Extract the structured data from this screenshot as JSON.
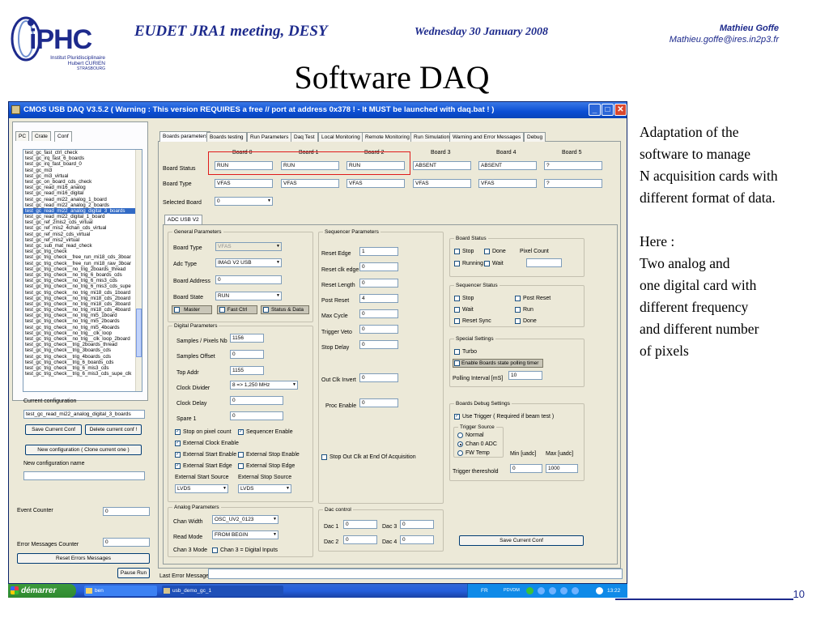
{
  "slide": {
    "meeting": "EUDET JRA1 meeting, DESY",
    "date": "Wednesday 30 January 2008",
    "author_name": "Mathieu Goffe",
    "author_email": "Mathieu.goffe@ires.in2p3.fr",
    "title": "Software DAQ",
    "page_number": "10",
    "logo": {
      "main": "iPHC",
      "line1": "Institut Pluridisciplinaire",
      "line2": "Hubert CURIEN",
      "line3": "STRASBOURG"
    },
    "side_text_1": "Adaptation of the\nsoftware to manage\nN acquisition cards with\ndifferent format of data.",
    "side_text_2": "Here :\nTwo analog and\none digital card with\ndifferent frequency\nand different number\nof pixels"
  },
  "window": {
    "title": "CMOS USB DAQ V3.5.2  ( Warning : This version REQUIRES a free // port at address 0x378 ! - It MUST be launched with daq.bat ! )",
    "btn_min": "_",
    "btn_max": "□",
    "btn_close": "✕"
  },
  "left": {
    "tabs": [
      "PC",
      "Crate",
      "Conf"
    ],
    "configs": [
      "test_gc_fast_ctrl_check",
      "test_gc_irq_fast_6_boards",
      "test_gc_irq_fast_board_0",
      "test_gc_mi3",
      "test_gc_mi3_virtual",
      "test_gc_on_board_cds_check",
      "test_gc_read_mi16_analog",
      "test_gc_read_mi16_digital",
      "test_gc_read_mi22_analog_1_board",
      "test_gc_read_mi22_analog_2_boards",
      "test_gc_read_mi22_analog_digital_3_boards",
      "test_gc_read_mi22_digital_1_board",
      "test_gc_ref_2mis2_cds_virtual",
      "test_gc_ref_mis2_4chan_cds_virtual",
      "test_gc_ref_mis2_cds_virtual",
      "test_gc_ref_mis2_virtual",
      "test_gc_sub_mat_read_check",
      "test_gc_trig_check",
      "test_gc_trig_check__free_run_mi18_cds_3boar",
      "test_gc_trig_check__free_run_mi18_raw_3boar",
      "test_gc_trig_check__no_trig_2boards_thread",
      "test_gc_trig_check__no_trig_6_boards_cds",
      "test_gc_trig_check__no_trig_6_mis3_cds",
      "test_gc_trig_check__no_trig_6_mis3_cds_supe",
      "test_gc_trig_check__no_trig_mi18_cds_1board",
      "test_gc_trig_check__no_trig_mi18_cds_2board",
      "test_gc_trig_check__no_trig_mi18_cds_3board",
      "test_gc_trig_check__no_trig_mi18_cds_4board",
      "test_gc_trig_check__no_trig_mi5_1board",
      "test_gc_trig_check__no_trig_mi5_2boards",
      "test_gc_trig_check__no_trig_mi5_4boards",
      "test_gc_trig_check__no_trig__clk_loop",
      "test_gc_trig_check__no_trig__clk_loop_2board",
      "test_gc_trig_check__trig_2boards_thread",
      "test_gc_trig_check__trig_3boards_cds",
      "test_gc_trig_check__trig_4boards_cds",
      "test_gc_trig_check__trig_6_boards_cds",
      "test_gc_trig_check__trig_6_mis3_cds",
      "test_gc_trig_check__trig_6_mis3_cds_supe_clk"
    ],
    "selected_index": 10,
    "current_config_label": "Current configuration",
    "current_config_value": "test_gc_read_mi22_analog_digital_3_boards",
    "save_current": "Save Current Conf",
    "delete_current": "Delete current conf !",
    "new_config_btn": "New configuration ( Clone current one )",
    "new_config_name_label": "New configuration name",
    "new_config_name_value": "",
    "event_counter_label": "Event Counter",
    "event_counter_value": "0",
    "error_counter_label": "Error Messages Counter",
    "error_counter_value": "0",
    "reset_errors": "Reset Errors Messages",
    "pause_run": "Pause Run"
  },
  "main": {
    "tabs": [
      "Boards parameters",
      "Boards testing",
      "Run Parameters",
      "Daq Test",
      "Local Monitoring",
      "Remote Monitoring",
      "Run Simulation",
      "Warning and Error Messages",
      "Debug"
    ],
    "boards": [
      "Board 0",
      "Board 1",
      "Board 2",
      "Board 3",
      "Board 4",
      "Board 5"
    ],
    "board_status_label": "Board Status",
    "board_status": [
      "RUN",
      "RUN",
      "RUN",
      "ABSENT",
      "ABSENT",
      "?"
    ],
    "board_type_label": "Board Type",
    "board_type": [
      "VFAS",
      "VFAS",
      "VFAS",
      "VFAS",
      "VFAS",
      "?"
    ],
    "selected_board_label": "Selected Board",
    "selected_board": "0",
    "subtab": "ADC USB V2",
    "general": {
      "title": "General Parameters",
      "board_type_label": "Board Type",
      "board_type": "VFAS",
      "adc_type_label": "Adc Type",
      "adc_type": "IMAG V2 USB",
      "board_address_label": "Board Address",
      "board_address": "0",
      "board_state_label": "Board State",
      "board_state": "RUN",
      "master": "Master",
      "fast_ctrl": "Fast Ctrl",
      "status_data": "Status & Data"
    },
    "digital": {
      "title": "Digital Parameters",
      "samples_label": "Samples / Pixels Nb",
      "samples": "1156",
      "samples_offset_label": "Samples Offset",
      "samples_offset": "0",
      "top_addr_label": "Top Addr",
      "top_addr": "1155",
      "clock_divider_label": "Clock Divider",
      "clock_divider": "8 =>   1,250 MHz",
      "clock_delay_label": "Clock Delay",
      "clock_delay": "0",
      "spare1_label": "Spare 1",
      "spare1": "0",
      "stop_on_pixel": "Stop on pixel count",
      "sequencer_enable": "Sequencer Enable",
      "ext_clock_enable": "External Clock Enable",
      "ext_start_enable": "External Start Enable",
      "ext_stop_enable": "External Stop Enable",
      "ext_start_edge": "External Start Edge",
      "ext_stop_edge": "External Stop Edge",
      "ext_start_source_label": "External Start Source",
      "ext_stop_source_label": "External Stop Source",
      "ext_start_source": "LVDS",
      "ext_stop_source": "LVDS"
    },
    "analog": {
      "title": "Analog Parameters",
      "chan_width_label": "Chan Width",
      "chan_width": "OSC_UV2_0123",
      "read_mode_label": "Read Mode",
      "read_mode": "FROM BEGIN",
      "chan3_mode_label": "Chan 3 Mode",
      "chan3_digital": "Chan 3  = Digital Inputs"
    },
    "sequencer": {
      "title": "Sequencer Parameters",
      "reset_edge_label": "Reset Edge",
      "reset_edge": "1",
      "reset_clk_edge_label": "Reset clk edge",
      "reset_clk_edge": "0",
      "reset_length_label": "Reset Length",
      "reset_length": "0",
      "post_reset_label": "Post Reset",
      "post_reset": "4",
      "max_cycle_label": "Max Cycle",
      "max_cycle": "0",
      "trigger_veto_label": "Trigger Veto",
      "trigger_veto": "0",
      "stop_delay_label": "Stop Delay",
      "stop_delay": "0",
      "out_clk_invert_label": "Out Clk Invert",
      "out_clk_invert": "0",
      "proc_enable_label": "Proc Enable",
      "proc_enable": "0",
      "stop_out_clk": "Stop Out Clk at End Of Acquisition"
    },
    "dac": {
      "title": "Dac control",
      "dac1_label": "Dac 1",
      "dac1": "0",
      "dac2_label": "Dac 2",
      "dac2": "0",
      "dac3_label": "Dac 3",
      "dac3": "0",
      "dac4_label": "Dac 4",
      "dac4": "0"
    },
    "board_status_grp": {
      "title": "Board Status",
      "stop": "Stop",
      "done": "Done",
      "pixel_count_label": "Pixel Count",
      "pixel_count": "",
      "running": "Running",
      "wait": "Wait"
    },
    "seq_status": {
      "title": "Sequencer Status",
      "stop": "Stop",
      "post_reset": "Post Reset",
      "wait": "Wait",
      "run": "Run",
      "reset_sync": "Reset Sync",
      "done": "Done"
    },
    "special": {
      "title": "Special Settings",
      "turbo": "Turbo",
      "polling_timer": "Enable Boards state polling timer",
      "polling_interval_label": "Polling Interval [mS]",
      "polling_interval": "10"
    },
    "debug": {
      "title": "Boards Debug Settings",
      "use_trigger": "Use Trigger ( Required if beam test )",
      "trigger_source_title": "Trigger Source",
      "normal": "Normal",
      "chan0_adc": "Chan 0 ADC",
      "fw_temp": "FW Temp",
      "min_label": "Min [uadc]",
      "max_label": "Max [uadc]",
      "threshold_label": "Trigger thereshold",
      "min": "0",
      "max": "1000"
    },
    "save_conf": "Save Current Conf",
    "last_error_label": "Last Error Message",
    "last_error": ""
  },
  "taskbar": {
    "start": "démarrer",
    "item1": "ben",
    "item2": "usb_demo_gc_1",
    "lang": "FR",
    "tray_text": "PDVDM",
    "clock": "13:22"
  }
}
